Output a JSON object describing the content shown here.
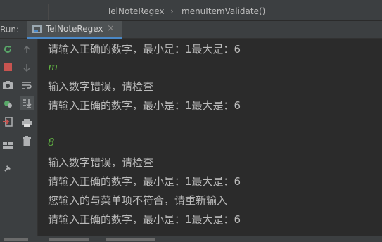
{
  "breadcrumb": {
    "file": "TelNoteRegex",
    "separator": "›",
    "method": "menuItemValidate()"
  },
  "run_panel": {
    "label": "Run:",
    "tab_label": "TelNoteRegex",
    "close_glyph": "×"
  },
  "toolbar_icons": [
    "rerun-icon",
    "stop-icon",
    "camera-icon",
    "debug-settings-icon",
    "exit-icon",
    "layout-icon",
    "pin-icon",
    "up-arrow-icon",
    "down-arrow-icon",
    "soft-wrap-icon",
    "scroll-to-end-icon",
    "print-icon",
    "trash-icon"
  ],
  "console": {
    "lines": [
      {
        "type": "output",
        "text": "请输入正确的数字，最小是：1最大是：6"
      },
      {
        "type": "input",
        "text": "m"
      },
      {
        "type": "output",
        "text": "输入数字错误，请检查"
      },
      {
        "type": "output",
        "text": "请输入正确的数字，最小是：1最大是：6"
      },
      {
        "type": "blank",
        "text": ""
      },
      {
        "type": "input",
        "text": "8"
      },
      {
        "type": "output",
        "text": "输入数字错误，请检查"
      },
      {
        "type": "output",
        "text": "请输入正确的数字，最小是：1最大是：6"
      },
      {
        "type": "output",
        "text": "您输入的与菜单项不符合，请重新输入"
      },
      {
        "type": "output",
        "text": "请输入正确的数字，最小是：1最大是：6"
      }
    ]
  },
  "colors": {
    "background": "#2b2b2b",
    "toolbar": "#3c3f41",
    "output_text": "#bbbbbb",
    "input_text": "#62b543",
    "accent": "#4a88c7",
    "stop_red": "#c75450",
    "rerun_green": "#59a869"
  }
}
